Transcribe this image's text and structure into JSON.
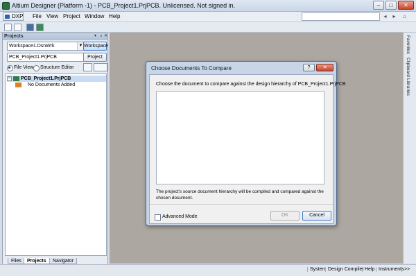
{
  "window": {
    "title": "Altium Designer (Platform -1) - PCB_Project1.PrjPCB. Unlicensed. Not signed in.",
    "minimize": "–",
    "maximize": "□",
    "close": "✕"
  },
  "menu": {
    "dxp": "DXP",
    "items": [
      "File",
      "View",
      "Project",
      "Window",
      "Help"
    ]
  },
  "nav": {
    "back": "◂",
    "forward": "▸",
    "home": "⌂"
  },
  "panel": {
    "title": "Projects",
    "header_buttons": [
      "▾",
      "◃",
      "✕"
    ],
    "workspace_value": "Workspace1.DsnWrk",
    "workspace_button": "Workspace",
    "project_value": "PCB_Project1.PrjPCB",
    "project_button": "Project",
    "view_options": [
      "File View",
      "Structure Editor"
    ],
    "tree": [
      {
        "expander": "−",
        "label": "PCB_Project1.PrjPCB"
      },
      {
        "expander": "",
        "label": "No Documents Added"
      }
    ],
    "tabs": [
      "Files",
      "Projects",
      "Navigator"
    ]
  },
  "right_tabs": [
    "Favorites",
    "Clipboard",
    "Libraries"
  ],
  "status": {
    "items": [
      "System",
      "Design Compiler",
      "Help",
      "Instruments",
      ">>"
    ]
  },
  "dialog": {
    "title": "Choose Documents To Compare",
    "help": "?",
    "close": "✕",
    "prompt": "Choose the document to compare against the design hierarchy of PCB_Project1.PrjPCB",
    "note": "The project's source document hierarchy will be compiled and compared against the chosen document.",
    "advanced_mode": "Advanced Mode",
    "ok": "OK",
    "cancel": "Cancel"
  }
}
